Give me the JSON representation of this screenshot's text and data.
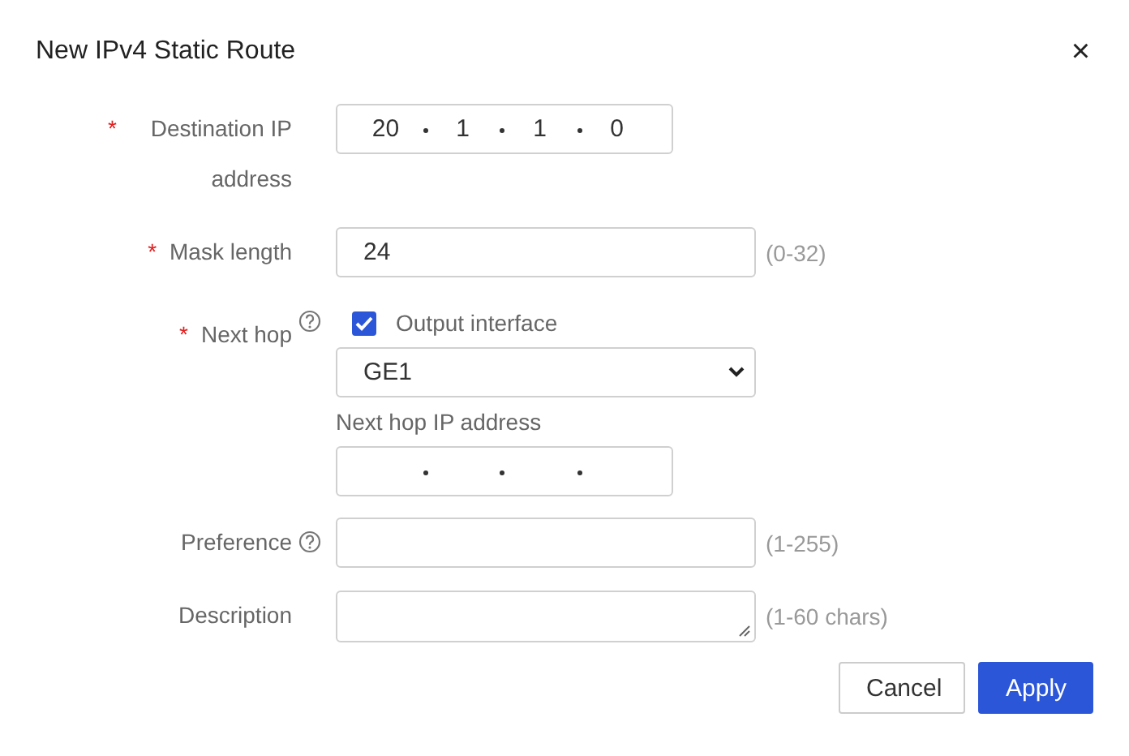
{
  "dialog": {
    "title": "New IPv4 Static Route",
    "close": "×",
    "required_mark": "*"
  },
  "fields": [
    {
      "kind": "ip",
      "label": "Destination IP address",
      "required": true,
      "help": false,
      "octets": [
        "20",
        "1",
        "1",
        "0"
      ]
    },
    {
      "kind": "text",
      "label": "Mask length",
      "required": true,
      "help": false,
      "value": "24",
      "hint": "(0-32)"
    },
    {
      "kind": "nexthop",
      "label": "Next hop",
      "required": true,
      "help": true,
      "checkbox": {
        "label": "Output interface",
        "checked": true
      },
      "select": "GE1",
      "sublabel": "Next hop IP address"
    },
    {
      "kind": "text",
      "label": "Preference",
      "required": false,
      "help": true,
      "hint": "(1-255)"
    },
    {
      "kind": "textarea",
      "label": "Description",
      "required": false,
      "help": false,
      "hint": "(1-60 chars)"
    }
  ],
  "buttons": [
    {
      "label": "Cancel",
      "primary": false
    },
    {
      "label": "Apply",
      "primary": true
    }
  ]
}
